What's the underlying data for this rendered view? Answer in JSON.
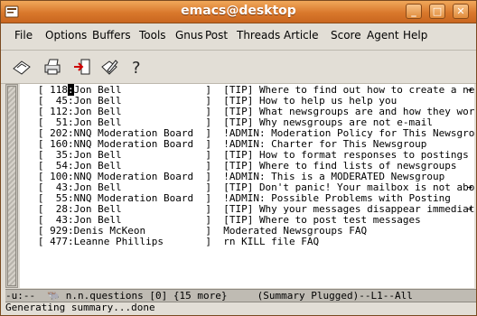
{
  "window": {
    "title": "emacs@desktop"
  },
  "menu": [
    "File",
    "Options",
    "Buffers",
    "Tools",
    "Gnus",
    "Post",
    "Threads",
    "Article",
    "Score",
    "Agent",
    "Help"
  ],
  "toolbar": {
    "icons": [
      "exit-icon",
      "print-icon",
      "get-messages-icon",
      "edit-icon",
      "help-icon"
    ]
  },
  "summary": {
    "rows": [
      {
        "count": "118",
        "author": "Jon Bell",
        "subject": "[TIP] Where to find out how to create a newsg",
        "more": true,
        "cursor": true
      },
      {
        "count": " 45",
        "author": "Jon Bell",
        "subject": "[TIP] How to help us help you",
        "more": false
      },
      {
        "count": "112",
        "author": "Jon Bell",
        "subject": "[TIP] What newsgroups are and how they work",
        "more": false
      },
      {
        "count": " 51",
        "author": "Jon Bell",
        "subject": "[TIP] Why newsgroups are not e-mail",
        "more": false
      },
      {
        "count": "202",
        "author": "NNQ Moderation Board",
        "subject": "!ADMIN: Moderation Policy for This Newsgroup",
        "more": false
      },
      {
        "count": "160",
        "author": "NNQ Moderation Board",
        "subject": "!ADMIN: Charter for This Newsgroup",
        "more": false
      },
      {
        "count": " 35",
        "author": "Jon Bell",
        "subject": "[TIP] How to format responses to postings",
        "more": false
      },
      {
        "count": " 54",
        "author": "Jon Bell",
        "subject": "[TIP] Where to find lists of newsgroups",
        "more": false
      },
      {
        "count": "100",
        "author": "NNQ Moderation Board",
        "subject": "!ADMIN: This is a MODERATED Newsgroup",
        "more": false
      },
      {
        "count": " 43",
        "author": "Jon Bell",
        "subject": "[TIP] Don't panic! Your mailbox is not about",
        "more": true
      },
      {
        "count": " 55",
        "author": "NNQ Moderation Board",
        "subject": "!ADMIN: Possible Problems with Posting",
        "more": false
      },
      {
        "count": " 28",
        "author": "Jon Bell",
        "subject": "[TIP] Why your messages disappear immediately",
        "more": true
      },
      {
        "count": " 43",
        "author": "Jon Bell",
        "subject": "[TIP] Where to post test messages",
        "more": false
      },
      {
        "count": "929",
        "author": "Denis McKeon",
        "subject": "Moderated Newsgroups FAQ",
        "more": false
      },
      {
        "count": "477",
        "author": "Leanne Phillips",
        "subject": "rn KILL file FAQ",
        "more": false
      }
    ]
  },
  "modeline": {
    "prefix": "-u:--",
    "text": "n.n.questions [0] {15 more}",
    "status": "(Summary Plugged)--L1--All"
  },
  "echo_area": "Generating summary...done",
  "colors": {
    "title_bar": "#d9782c",
    "modeline_icon": "#2a3ac8"
  }
}
